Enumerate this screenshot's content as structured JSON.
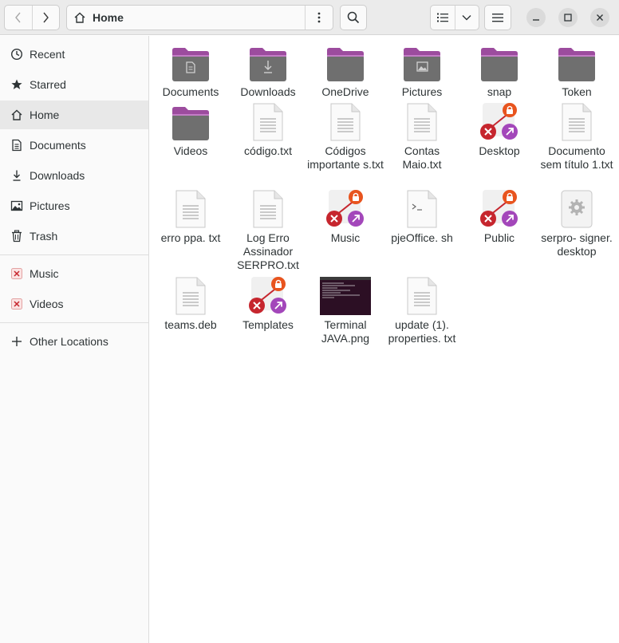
{
  "header": {
    "path_label": "Home"
  },
  "sidebar": {
    "items": [
      {
        "label": "Recent",
        "icon": "clock-icon"
      },
      {
        "label": "Starred",
        "icon": "star-icon"
      },
      {
        "label": "Home",
        "icon": "home-icon"
      },
      {
        "label": "Documents",
        "icon": "document-icon"
      },
      {
        "label": "Downloads",
        "icon": "download-icon"
      },
      {
        "label": "Pictures",
        "icon": "picture-icon"
      },
      {
        "label": "Trash",
        "icon": "trash-icon"
      }
    ],
    "bookmarks": [
      {
        "label": "Music",
        "icon": "broken-bookmark-icon"
      },
      {
        "label": "Videos",
        "icon": "broken-bookmark-icon"
      }
    ],
    "other_locations": "Other Locations"
  },
  "files": [
    {
      "label": "Documents",
      "type": "folder-documents"
    },
    {
      "label": "Downloads",
      "type": "folder-downloads"
    },
    {
      "label": "OneDrive",
      "type": "folder"
    },
    {
      "label": "Pictures",
      "type": "folder-pictures"
    },
    {
      "label": "snap",
      "type": "folder"
    },
    {
      "label": "Token",
      "type": "folder"
    },
    {
      "label": "Videos",
      "type": "folder"
    },
    {
      "label": "código.txt",
      "type": "text"
    },
    {
      "label": "Códigos importante s.txt",
      "type": "text"
    },
    {
      "label": "Contas Maio.txt",
      "type": "text"
    },
    {
      "label": "Desktop",
      "type": "broken-link"
    },
    {
      "label": "Documento sem título 1.txt",
      "type": "text"
    },
    {
      "label": "erro ppa. txt",
      "type": "text"
    },
    {
      "label": "Log Erro Assinador SERPRO.txt",
      "type": "text"
    },
    {
      "label": "Music",
      "type": "broken-link"
    },
    {
      "label": "pjeOffice. sh",
      "type": "script"
    },
    {
      "label": "Public",
      "type": "broken-link"
    },
    {
      "label": "serpro- signer. desktop",
      "type": "desktop"
    },
    {
      "label": "teams.deb",
      "type": "text"
    },
    {
      "label": "Templates",
      "type": "broken-link"
    },
    {
      "label": "Terminal JAVA.png",
      "type": "image"
    },
    {
      "label": "update (1). properties. txt",
      "type": "text"
    }
  ],
  "colors": {
    "folder_purple": "#9c4c9e",
    "folder_gray": "#6f6f6f",
    "lock_orange": "#e8541e",
    "x_red": "#c6262e",
    "link_purple": "#a347ba"
  }
}
